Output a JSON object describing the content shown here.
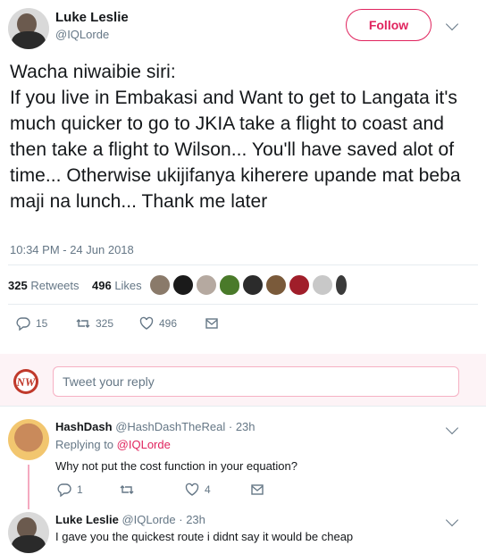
{
  "tweet": {
    "author_name": "Luke Leslie",
    "author_handle": "@IQLorde",
    "follow_label": "Follow",
    "text": "Wacha niwaibie siri:\nIf you live in Embakasi and Want to get to Langata it's much quicker to go to JKIA take a flight to coast and then take a flight to Wilson... You'll have saved alot of time... Otherwise ukijifanya kiherere upande mat beba maji na lunch... Thank me later",
    "timestamp": "10:34 PM - 24 Jun 2018",
    "retweets_count": "325",
    "retweets_label": "Retweets",
    "likes_count": "496",
    "likes_label": "Likes",
    "actions": {
      "replies": "15",
      "retweets": "325",
      "likes": "496"
    }
  },
  "reply_box": {
    "placeholder": "Tweet your reply",
    "logo_text": "NW"
  },
  "replies": [
    {
      "author_name": "HashDash",
      "author_handle": "@HashDashTheReal",
      "time": "23h",
      "replying_to_label": "Replying to",
      "replying_to_handle": "@IQLorde",
      "text": "Why not put the cost function in your equation?",
      "actions": {
        "replies": "1",
        "retweets": "",
        "likes": "4"
      }
    },
    {
      "author_name": "Luke Leslie",
      "author_handle": "@IQLorde",
      "time": "23h",
      "text": "I gave you the quickest route i didnt say it would be cheap"
    }
  ],
  "colors": {
    "accent": "#e0245e",
    "muted": "#657786",
    "text": "#14171a",
    "divider": "#e6ecf0"
  },
  "icons": [
    "reply-icon",
    "retweet-icon",
    "like-icon",
    "message-icon",
    "chevron-down-icon"
  ]
}
